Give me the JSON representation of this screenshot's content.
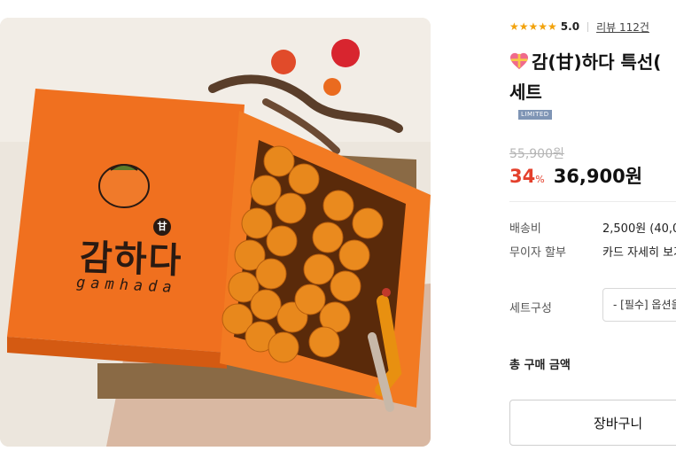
{
  "product": {
    "rating": {
      "stars": "★★★★★",
      "score": "5.0",
      "review_link": "리뷰 112건"
    },
    "title_line1": "감(甘)하다 특선(",
    "title_line2": "세트",
    "badge": "LIMITED",
    "original_price": "55,900원",
    "discount_value": "34",
    "discount_unit": "%",
    "sale_price": "36,900원"
  },
  "image": {
    "brand_text": "감하다",
    "brand_sub": "gamhada",
    "brand_tag": "甘"
  },
  "info": {
    "shipping_label": "배송비",
    "shipping_value": "2,500원 (40,0",
    "installment_label": "무이자 할부",
    "installment_value": "카드 자세히 보기",
    "set_label": "세트구성",
    "set_placeholder": "- [필수] 옵션을 선택해 주세요 -",
    "total_label": "총 구매 금액"
  },
  "actions": {
    "cart_button": "장바구니"
  },
  "colors": {
    "star": "#f2a20b",
    "discount": "#e4402c",
    "badge": "#7f95b5",
    "box_orange": "#f0701f"
  }
}
